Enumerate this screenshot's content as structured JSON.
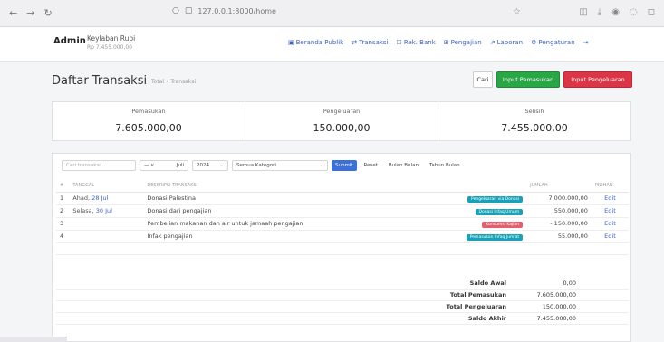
{
  "browser": {
    "url": "127.0.0.1:8000/home"
  },
  "header": {
    "brand": "Admin",
    "user_name": "Keylaban Rubi",
    "user_sub": "Rp 7.455.000,00",
    "menu": [
      {
        "icon": "▣",
        "label": "Beranda Publik"
      },
      {
        "icon": "⇄",
        "label": "Transaksi"
      },
      {
        "icon": "☐",
        "label": "Rek. Bank"
      },
      {
        "icon": "⊞",
        "label": "Pengajian"
      },
      {
        "icon": "⇗",
        "label": "Laporan"
      },
      {
        "icon": "⚙",
        "label": "Pengaturan"
      },
      {
        "icon": "⇥",
        "label": ""
      }
    ]
  },
  "page": {
    "title": "Daftar Transaksi",
    "breadcrumb": "Total • Transaksi",
    "buttons": {
      "cari": "Cari",
      "masuk": "Input Pemasukan",
      "keluar": "Input Pengeluaran"
    }
  },
  "summary": [
    {
      "label": "Pemasukan",
      "value": "7.605.000,00"
    },
    {
      "label": "Pengeluaran",
      "value": "150.000,00"
    },
    {
      "label": "Selisih",
      "value": "7.455.000,00"
    }
  ],
  "filters": {
    "search_placeholder": "Cari transaksi...",
    "month": "Juli",
    "year": "2024",
    "category": "Semua Kategori",
    "submit": "Submit",
    "reset": "Reset",
    "export_excel": "Bulan Bulan",
    "export_pdf": "Tahun Bulan",
    "arrow": "⌄",
    "prefix": "— ∨"
  },
  "table": {
    "headers": [
      "#",
      "TANGGAL",
      "DESKRIPSI TRANSAKSI",
      "",
      "JUMLAH",
      "PILIHAN"
    ],
    "rows": [
      {
        "no": "1",
        "day": "Ahad,",
        "date": "28 Jul",
        "desc": "Donasi Palestina",
        "badge": "Pengeluaran via Donasi",
        "badge_color": "#17a2b8",
        "amount": "7.000.000,00",
        "action": "Edit"
      },
      {
        "no": "2",
        "day": "Selasa,",
        "date": "30 Jul",
        "desc": "Donasi dari pengajian",
        "badge": "Donasi Infaq Umum",
        "badge_color": "#17a2b8",
        "amount": "550.000,00",
        "action": "Edit"
      },
      {
        "no": "3",
        "day": "",
        "date": "",
        "desc": "Pembelian makanan dan air untuk jamaah pengajian",
        "badge": "Konsumsi Kajian",
        "badge_color": "#e4606d",
        "amount": "- 150.000,00",
        "action": "Edit"
      },
      {
        "no": "4",
        "day": "",
        "date": "",
        "desc": "Infak pengajian",
        "badge": "Pemasukan Infaq Jum'at",
        "badge_color": "#17a2b8",
        "amount": "55.000,00",
        "action": "Edit"
      }
    ]
  },
  "totals": [
    {
      "label": "Saldo Awal",
      "value": "0,00"
    },
    {
      "label": "Total Pemasukan",
      "value": "7.605.000,00"
    },
    {
      "label": "Total Pengeluaran",
      "value": "150.000,00"
    },
    {
      "label": "Saldo Akhir",
      "value": "7.455.000,00"
    }
  ],
  "colors": {
    "primary": "#3a62c8",
    "success": "#28a745",
    "danger": "#dc3545"
  }
}
